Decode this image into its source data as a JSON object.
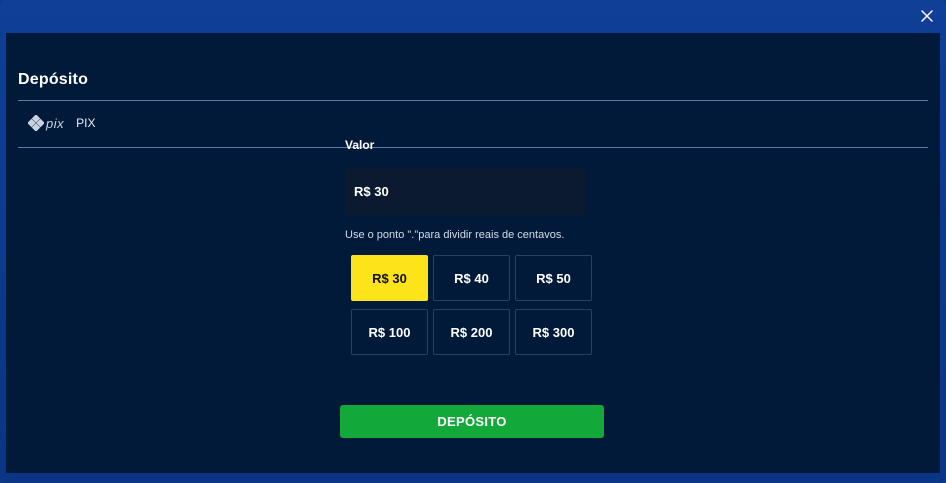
{
  "modal": {
    "title": "Depósito",
    "close_icon": "close-icon"
  },
  "payment_method": {
    "logo_text": "pix",
    "label": "PIX"
  },
  "form": {
    "value_label": "Valor",
    "amount_value": "R$ 30",
    "hint": "Use o ponto \".\"para dividir reais de centavos.",
    "amounts": [
      "R$ 30",
      "R$ 40",
      "R$ 50",
      "R$ 100",
      "R$ 200",
      "R$ 300"
    ],
    "selected_amount": "R$ 30",
    "submit_label": "DEPÓSITO"
  },
  "colors": {
    "accent_yellow": "#fde31a",
    "submit_green": "#12a83a",
    "panel_bg": "#021a3a",
    "frame_blue": "#0d3a8c"
  }
}
